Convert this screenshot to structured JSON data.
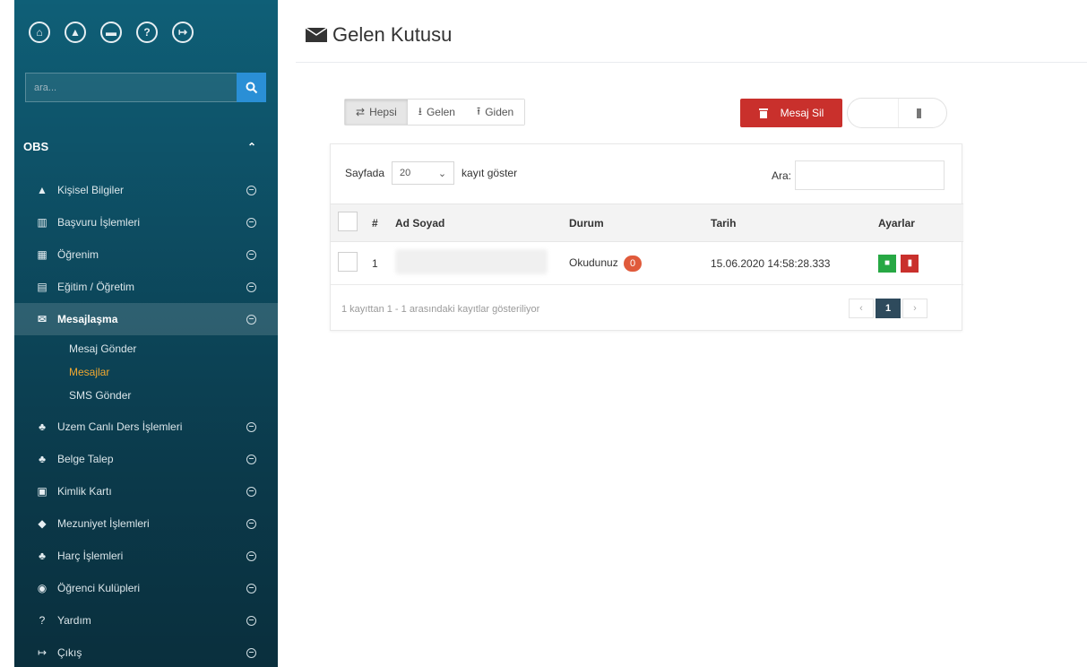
{
  "sidebar": {
    "top_icons": [
      {
        "name": "home-icon",
        "glyph": "⌂"
      },
      {
        "name": "user-icon",
        "glyph": "▲"
      },
      {
        "name": "chat-icon",
        "glyph": "▬"
      },
      {
        "name": "help-icon",
        "glyph": "?"
      },
      {
        "name": "logout-icon",
        "glyph": "↦"
      }
    ],
    "search_placeholder": "ara...",
    "section_title": "OBS",
    "items": [
      {
        "label": "Kişisel Bilgiler",
        "icon": "user-icon",
        "glyph": "▲"
      },
      {
        "label": "Başvuru İşlemleri",
        "icon": "columns-icon",
        "glyph": "▥"
      },
      {
        "label": "Öğrenim",
        "icon": "book-icon",
        "glyph": "▦"
      },
      {
        "label": "Eğitim / Öğretim",
        "icon": "file-icon",
        "glyph": "▤"
      },
      {
        "label": "Mesajlaşma",
        "icon": "envelope-icon",
        "glyph": "✉"
      },
      {
        "label": "Uzem Canlı Ders İşlemleri",
        "icon": "sitemap-icon",
        "glyph": "♣"
      },
      {
        "label": "Belge Talep",
        "icon": "sitemap-icon",
        "glyph": "♣"
      },
      {
        "label": "Kimlik Kartı",
        "icon": "id-card-icon",
        "glyph": "▣"
      },
      {
        "label": "Mezuniyet İşlemleri",
        "icon": "graduation-cap-icon",
        "glyph": "◆"
      },
      {
        "label": "Harç İşlemleri",
        "icon": "sitemap-icon",
        "glyph": "♣"
      },
      {
        "label": "Öğrenci Kulüpleri",
        "icon": "compass-icon",
        "glyph": "◉"
      },
      {
        "label": "Yardım",
        "icon": "question-icon",
        "glyph": "?"
      },
      {
        "label": "Çıkış",
        "icon": "sign-out-icon",
        "glyph": "↦"
      }
    ],
    "submenu": [
      "Mesaj Gönder",
      "Mesajlar",
      "SMS Gönder"
    ]
  },
  "page": {
    "title": "Gelen Kutusu",
    "tabs": [
      "Hepsi",
      "Gelen",
      "Giden"
    ],
    "delete_label": "Mesaj Sil"
  },
  "table": {
    "page_size_prefix": "Sayfada",
    "page_size_value": "20",
    "page_size_suffix": "kayıt göster",
    "search_label": "Ara:",
    "headers": [
      "#",
      "Ad Soyad",
      "Durum",
      "Tarih",
      "Ayarlar"
    ],
    "rows": [
      {
        "no": "1",
        "name": "",
        "status": "Okudunuz",
        "badge": "0",
        "date": "15.06.2020 14:58:28.333"
      }
    ],
    "info": "1 kayıttan 1 - 1 arasındaki kayıtlar gösteriliyor",
    "pager": {
      "prev": "‹",
      "current": "1",
      "next": "›"
    }
  },
  "colors": {
    "sidebar_top": "#0f5f77",
    "sidebar_bottom": "#0a2f3d",
    "accent_blue": "#2a8fd6",
    "danger": "#c9302c",
    "success": "#27a844",
    "submenu_selected": "#f0a830",
    "badge": "#e05a3b",
    "pager_active": "#2e4a5c"
  }
}
